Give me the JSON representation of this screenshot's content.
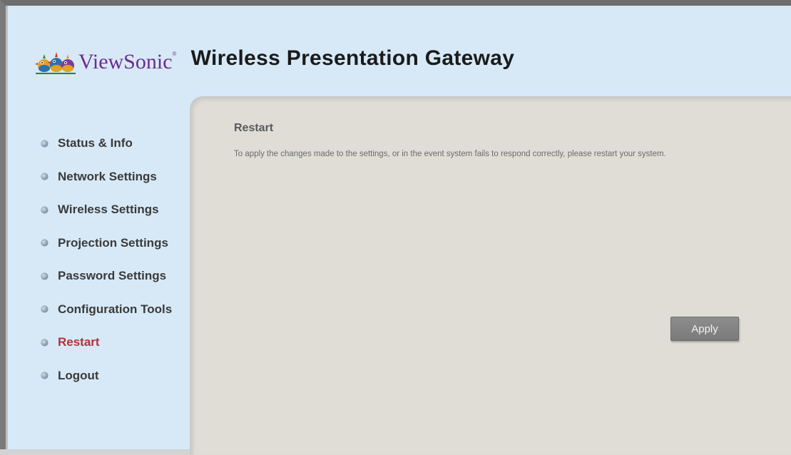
{
  "header": {
    "brand_name": "ViewSonic",
    "brand_mark": "®",
    "product_title": "Wireless Presentation Gateway",
    "logo_icon": "viewsonic-birds-logo"
  },
  "sidebar": {
    "items": [
      {
        "label": "Status & Info",
        "active": false
      },
      {
        "label": "Network Settings",
        "active": false
      },
      {
        "label": "Wireless Settings",
        "active": false
      },
      {
        "label": "Projection Settings",
        "active": false
      },
      {
        "label": "Password Settings",
        "active": false
      },
      {
        "label": "Configuration Tools",
        "active": false
      },
      {
        "label": "Restart",
        "active": true
      },
      {
        "label": "Logout",
        "active": false
      }
    ]
  },
  "main": {
    "title": "Restart",
    "description": "To apply the changes made to the settings, or in the event system fails to respond correctly, please restart your system.",
    "apply_label": "Apply"
  },
  "colors": {
    "background": "#d7e9f7",
    "panel": "#dfddd6",
    "active_nav": "#b2323a",
    "brand": "#6b2c8e"
  }
}
